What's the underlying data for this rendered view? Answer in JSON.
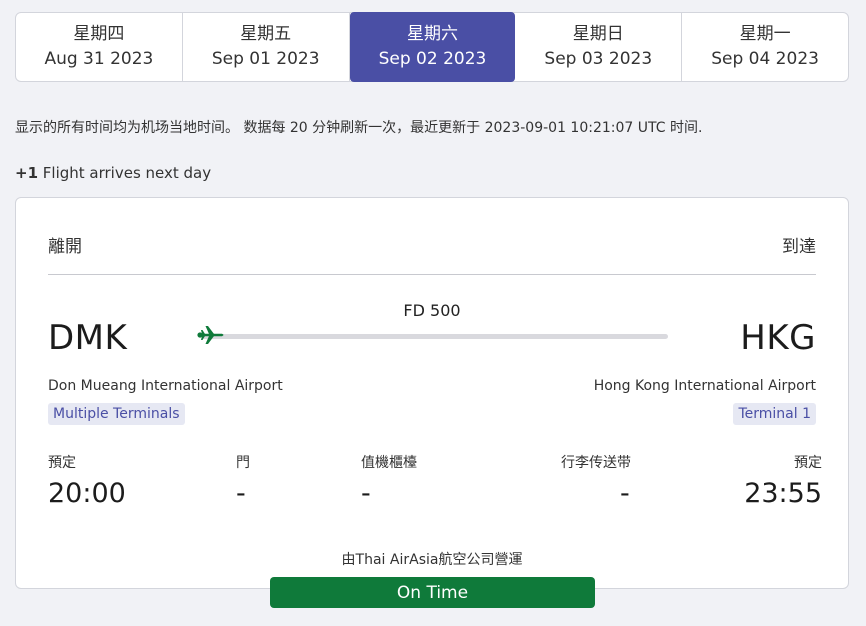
{
  "tabs": [
    {
      "dow": "星期四",
      "date": "Aug 31 2023"
    },
    {
      "dow": "星期五",
      "date": "Sep 01 2023"
    },
    {
      "dow": "星期六",
      "date": "Sep 02 2023"
    },
    {
      "dow": "星期日",
      "date": "Sep 03 2023"
    },
    {
      "dow": "星期一",
      "date": "Sep 04 2023"
    }
  ],
  "active_tab": 2,
  "notice": "显示的所有时间均为机场当地时间。 数据每 20 分钟刷新一次，最近更新于 2023-09-01 10:21:07 UTC 时间.",
  "next_day": {
    "marker": "+1",
    "text": " Flight arrives next day"
  },
  "card": {
    "header_departure": "離開",
    "header_arrival": "到達",
    "flight_number": "FD 500",
    "departure": {
      "code": "DMK",
      "airport": "Don Mueang International Airport",
      "terminal": "Multiple Terminals"
    },
    "arrival": {
      "code": "HKG",
      "airport": "Hong Kong International Airport",
      "terminal": "Terminal 1"
    },
    "details": {
      "scheduled_dep_label": "預定",
      "scheduled_dep_value": "20:00",
      "gate_label": "門",
      "gate_value": "-",
      "checkin_label": "值機櫃檯",
      "checkin_value": "-",
      "baggage_label": "行李传送带",
      "baggage_value": "-",
      "scheduled_arr_label": "預定",
      "scheduled_arr_value": "23:55"
    },
    "operator": "由Thai AirAsia航空公司營運",
    "status": "On Time"
  },
  "colors": {
    "accent": "#4a4fa5",
    "status_green": "#0f7a3a",
    "plane_green": "#0f7a3a"
  },
  "icons": {
    "plane": "plane-icon"
  }
}
